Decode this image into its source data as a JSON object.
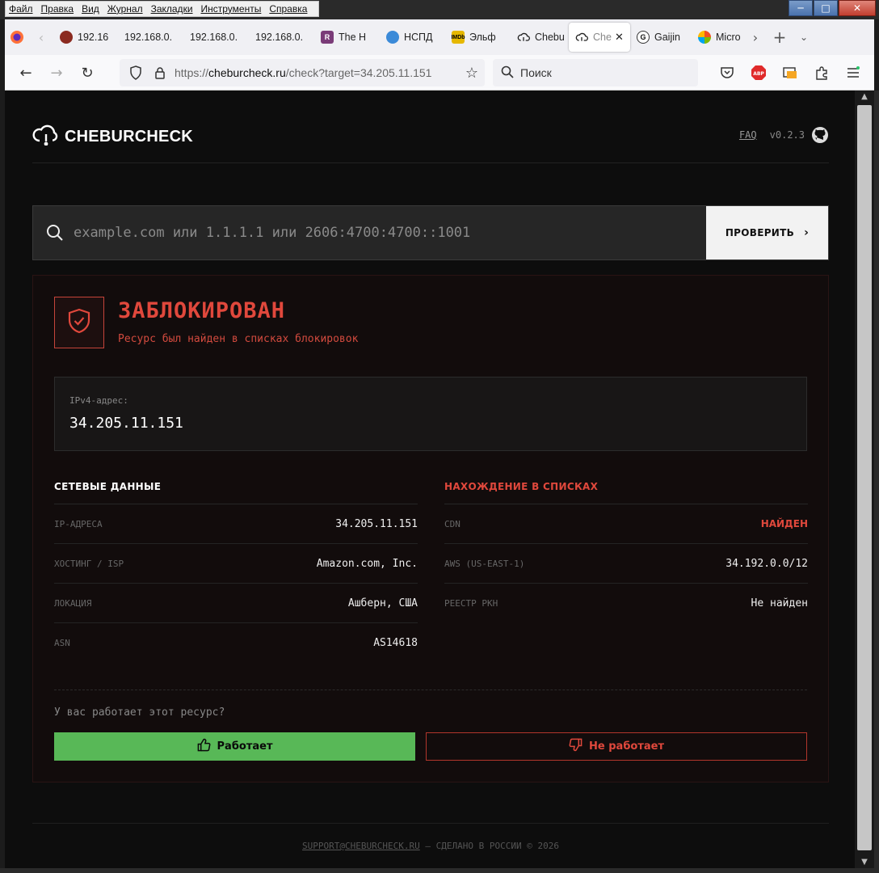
{
  "menubar": {
    "items": [
      "Файл",
      "Правка",
      "Вид",
      "Журнал",
      "Закладки",
      "Инструменты",
      "Справка"
    ]
  },
  "tabs": [
    {
      "label": "192.16",
      "color": "#8b2a20"
    },
    {
      "label": "192.168.0.",
      "color": ""
    },
    {
      "label": "192.168.0.",
      "color": ""
    },
    {
      "label": "192.168.0.",
      "color": ""
    },
    {
      "label": "The H",
      "color": "#7a3b78"
    },
    {
      "label": "НСПД",
      "color": "#3b8ad8"
    },
    {
      "label": "Эльф",
      "color": "#e6b800"
    },
    {
      "label": "Chebu",
      "color": ""
    },
    {
      "label": "Che",
      "color": ""
    },
    {
      "label": "Gaijin",
      "color": "#222"
    },
    {
      "label": "Micro",
      "color": "#7fbf3f"
    }
  ],
  "navbar": {
    "url_prefix": "https://",
    "url_host": "cheburcheck.ru",
    "url_path": "/check?target=34.205.11.151",
    "search_placeholder": "Поиск"
  },
  "site": {
    "logo": "CHEBURCHECK",
    "faq": "FAQ",
    "version": "v0.2.3"
  },
  "search": {
    "placeholder": "example.com или 1.1.1.1 или 2606:4700:4700::1001",
    "button": "ПРОВЕРИТЬ"
  },
  "result": {
    "status": "ЗАБЛОКИРОВАН",
    "status_sub": "Ресурс был найден в списках блокировок",
    "status_color": "#e0483c",
    "ip_label": "IPv4-адрес:",
    "ip_value": "34.205.11.151",
    "network": {
      "title": "СЕТЕВЫЕ ДАННЫЕ",
      "rows": [
        {
          "k": "IP-АДРЕСА",
          "v": "34.205.11.151"
        },
        {
          "k": "ХОСТИНГ / ISP",
          "v": "Amazon.com, Inc."
        },
        {
          "k": "ЛОКАЦИЯ",
          "v": "Ашберн, США"
        },
        {
          "k": "ASN",
          "v": "AS14618"
        }
      ]
    },
    "lists": {
      "title": "НАХОЖДЕНИЕ В СПИСКАХ",
      "rows": [
        {
          "k": "CDN",
          "v": "НАЙДЕН"
        },
        {
          "k": "AWS (US-EAST-1)",
          "v": "34.192.0.0/12"
        },
        {
          "k": "РЕЕСТР РКН",
          "v": "Не найден"
        }
      ]
    },
    "question": "У вас работает этот ресурс?",
    "works_button": "Работает",
    "broken_button": "Не работает"
  },
  "footer": {
    "email": "SUPPORT@CHEBURCHECK.RU",
    "text": " — СДЕЛАНО В РОССИИ © 2026"
  }
}
